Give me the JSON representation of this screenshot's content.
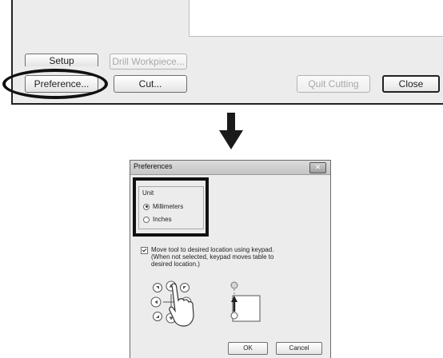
{
  "top_window": {
    "setup_label": "Setup",
    "drill_label": "Drill Workpiece...",
    "preference_label": "Preference...",
    "cut_label": "Cut...",
    "quit_label": "Quit Cutting",
    "close_label": "Close"
  },
  "dialog": {
    "title": "Preferences",
    "close_glyph": "✕",
    "unit": {
      "legend": "Unit",
      "options": [
        {
          "label": "Millimeters",
          "selected": true
        },
        {
          "label": "Inches",
          "selected": false
        }
      ]
    },
    "move_tool": {
      "checked": true,
      "line1": "Move tool to desired location using keypad.",
      "line2": "(When not selected, keypad moves table to",
      "line3": "desired location.)"
    },
    "ok_label": "OK",
    "cancel_label": "Cancel"
  },
  "icons": {
    "arrow": "down-arrow-icon",
    "keypad": "keypad-icon",
    "hand": "hand-pointer-icon",
    "tool_move": "tool-move-diagram-icon"
  },
  "colors": {
    "window_bg": "#ececec",
    "highlight_outline": "#111111"
  }
}
